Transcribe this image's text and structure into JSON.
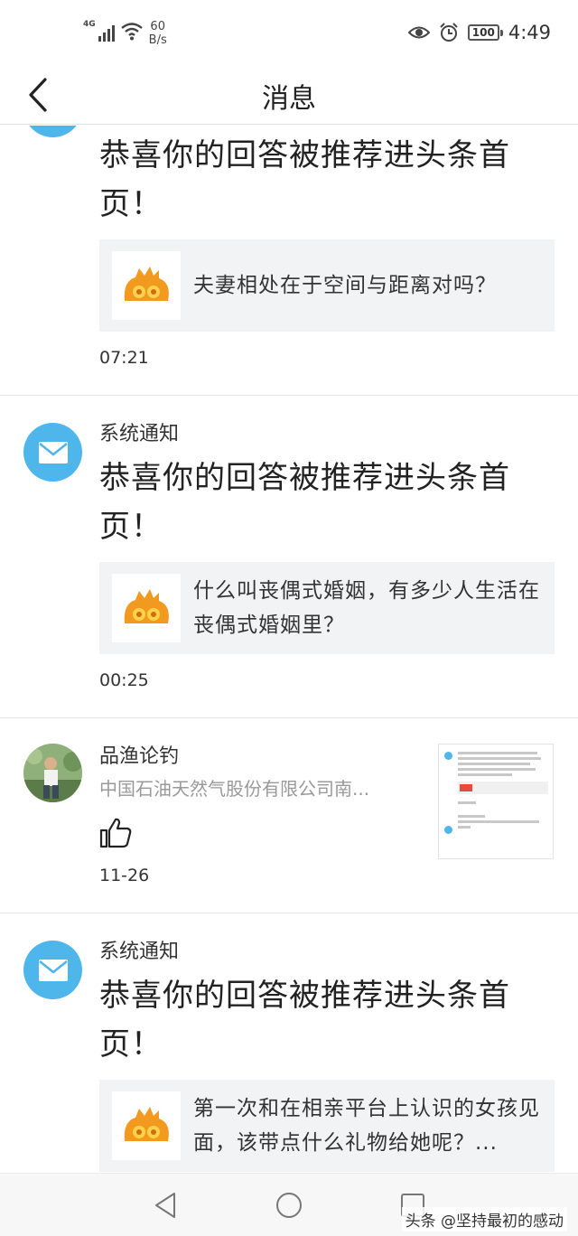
{
  "status_bar": {
    "network": "4G",
    "speed_value": "60",
    "speed_unit": "B/s",
    "battery": "100",
    "time": "4:49"
  },
  "header": {
    "title": "消息"
  },
  "messages": [
    {
      "sender": "",
      "headline_line1": "恭喜你的回答被推荐进头条首",
      "headline_line2": "页！",
      "card_text": "夫妻相处在于空间与距离对吗？",
      "time": "07:21"
    },
    {
      "sender": "系统通知",
      "headline_line1": "恭喜你的回答被推荐进头条首",
      "headline_line2": "页！",
      "card_text": "什么叫丧偶式婚姻，有多少人生活在丧偶式婚姻里？",
      "time": "00:25"
    },
    {
      "sender": "品渔论钓",
      "subtitle": "中国石油天然气股份有限公司南...",
      "time": "11-26"
    },
    {
      "sender": "系统通知",
      "headline_line1": "恭喜你的回答被推荐进头条首",
      "headline_line2": "页！",
      "card_text": "第一次和在相亲平台上认识的女孩见面，该带点什么礼物给她呢？..."
    }
  ],
  "watermark": "头条 @坚持最初的感动",
  "colors": {
    "accent_blue": "#4fb6ec",
    "card_bg": "#f1f3f5",
    "logo_orange": "#f29a1f"
  },
  "icons": [
    "back-arrow-icon",
    "mail-icon",
    "thumbs-up-icon",
    "nav-back-icon",
    "nav-home-icon",
    "nav-recents-icon"
  ]
}
